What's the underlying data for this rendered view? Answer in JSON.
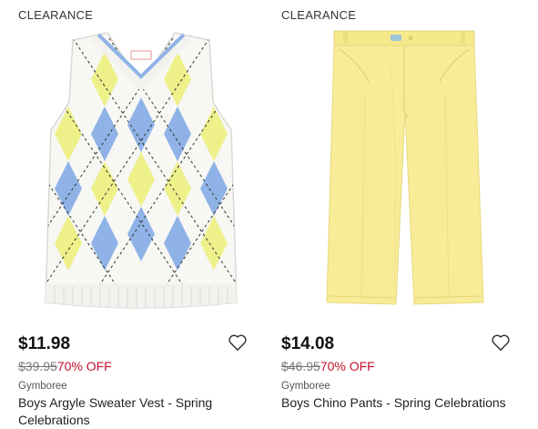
{
  "products": [
    {
      "badge": "CLEARANCE",
      "price": "$11.98",
      "original_price": "$39.95",
      "discount": "70% OFF",
      "brand": "Gymboree",
      "name": "Boys Argyle Sweater Vest - Spring Celebrations",
      "colors": {
        "knit": "#f7f7f4",
        "yellow": "#eef08a",
        "blue": "#8fb3e6"
      }
    },
    {
      "badge": "CLEARANCE",
      "price": "$14.08",
      "original_price": "$46.95",
      "discount": "70% OFF",
      "brand": "Gymboree",
      "name": "Boys Chino Pants - Spring Celebrations",
      "colors": {
        "fabric": "#f8ec98"
      }
    }
  ],
  "accent": {
    "sale_red": "#c8102e"
  }
}
